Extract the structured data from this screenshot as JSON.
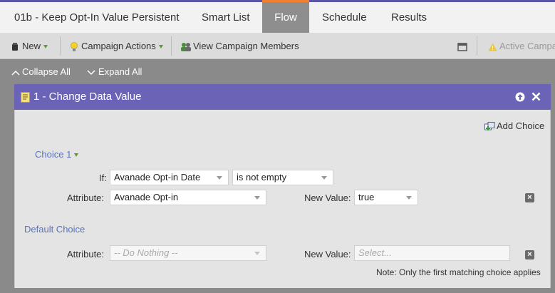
{
  "tabs": {
    "campaign": "01b - Keep Opt-In Value Persistent",
    "smart_list": "Smart List",
    "flow": "Flow",
    "schedule": "Schedule",
    "results": "Results"
  },
  "toolbar": {
    "new": "New",
    "campaign_actions": "Campaign Actions",
    "view_members": "View Campaign Members",
    "active": "Active Campaign"
  },
  "strip": {
    "collapse": "Collapse All",
    "expand": "Expand All"
  },
  "step": {
    "title": "1 - Change Data Value",
    "add_choice": "Add Choice",
    "choice1": {
      "label": "Choice 1",
      "if_label": "If:",
      "if_field": "Avanade Opt-in Date",
      "if_operator": "is not empty",
      "attribute_label": "Attribute:",
      "attribute": "Avanade Opt-in",
      "new_value_label": "New Value:",
      "new_value": "true"
    },
    "default_choice": {
      "label": "Default Choice",
      "attribute_label": "Attribute:",
      "attribute": "-- Do Nothing --",
      "new_value_label": "New Value:",
      "new_value_placeholder": "Select..."
    },
    "note": "Note: Only the first matching choice applies"
  },
  "colors": {
    "panel_header": "#6b63b5",
    "active_tab_accent": "#f08030",
    "link": "#5b73b8"
  }
}
